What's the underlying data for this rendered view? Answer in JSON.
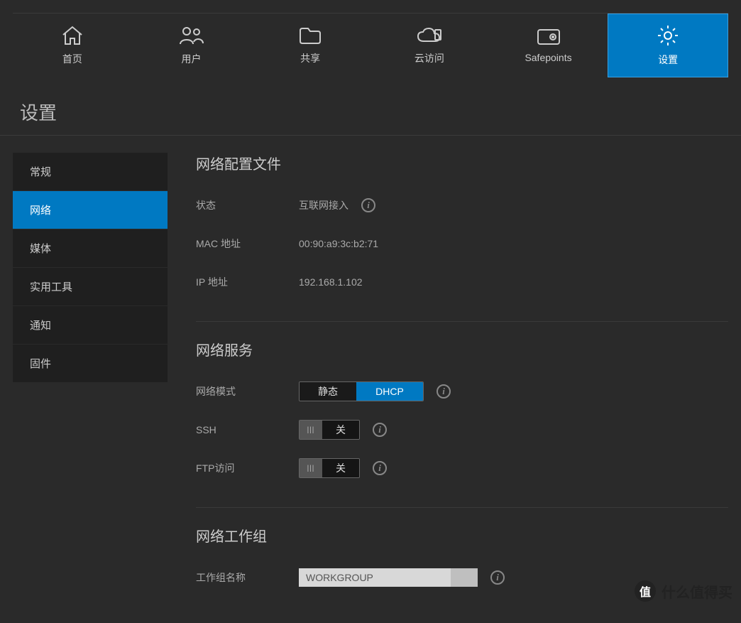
{
  "topnav": {
    "items": [
      {
        "label": "首页",
        "icon": "home-icon"
      },
      {
        "label": "用户",
        "icon": "users-icon"
      },
      {
        "label": "共享",
        "icon": "folder-icon"
      },
      {
        "label": "云访问",
        "icon": "cloud-icon"
      },
      {
        "label": "Safepoints",
        "icon": "safepoint-icon"
      },
      {
        "label": "设置",
        "icon": "gear-icon",
        "active": true
      }
    ]
  },
  "page_title": "设置",
  "sidebar": {
    "items": [
      {
        "label": "常规"
      },
      {
        "label": "网络",
        "active": true
      },
      {
        "label": "媒体"
      },
      {
        "label": "实用工具"
      },
      {
        "label": "通知"
      },
      {
        "label": "固件"
      }
    ]
  },
  "sections": {
    "profile": {
      "title": "网络配置文件",
      "status_label": "状态",
      "status_value": "互联网接入",
      "mac_label": "MAC 地址",
      "mac_value": "00:90:a9:3c:b2:71",
      "ip_label": "IP 地址",
      "ip_value": "192.168.1.102"
    },
    "services": {
      "title": "网络服务",
      "mode_label": "网络模式",
      "mode_static": "静态",
      "mode_dhcp": "DHCP",
      "ssh_label": "SSH",
      "ssh_state": "关",
      "ftp_label": "FTP访问",
      "ftp_state": "关"
    },
    "workgroup": {
      "title": "网络工作组",
      "name_label": "工作组名称",
      "name_value": "WORKGROUP"
    }
  },
  "watermark": "什么值得买",
  "watermark_badge": "值"
}
